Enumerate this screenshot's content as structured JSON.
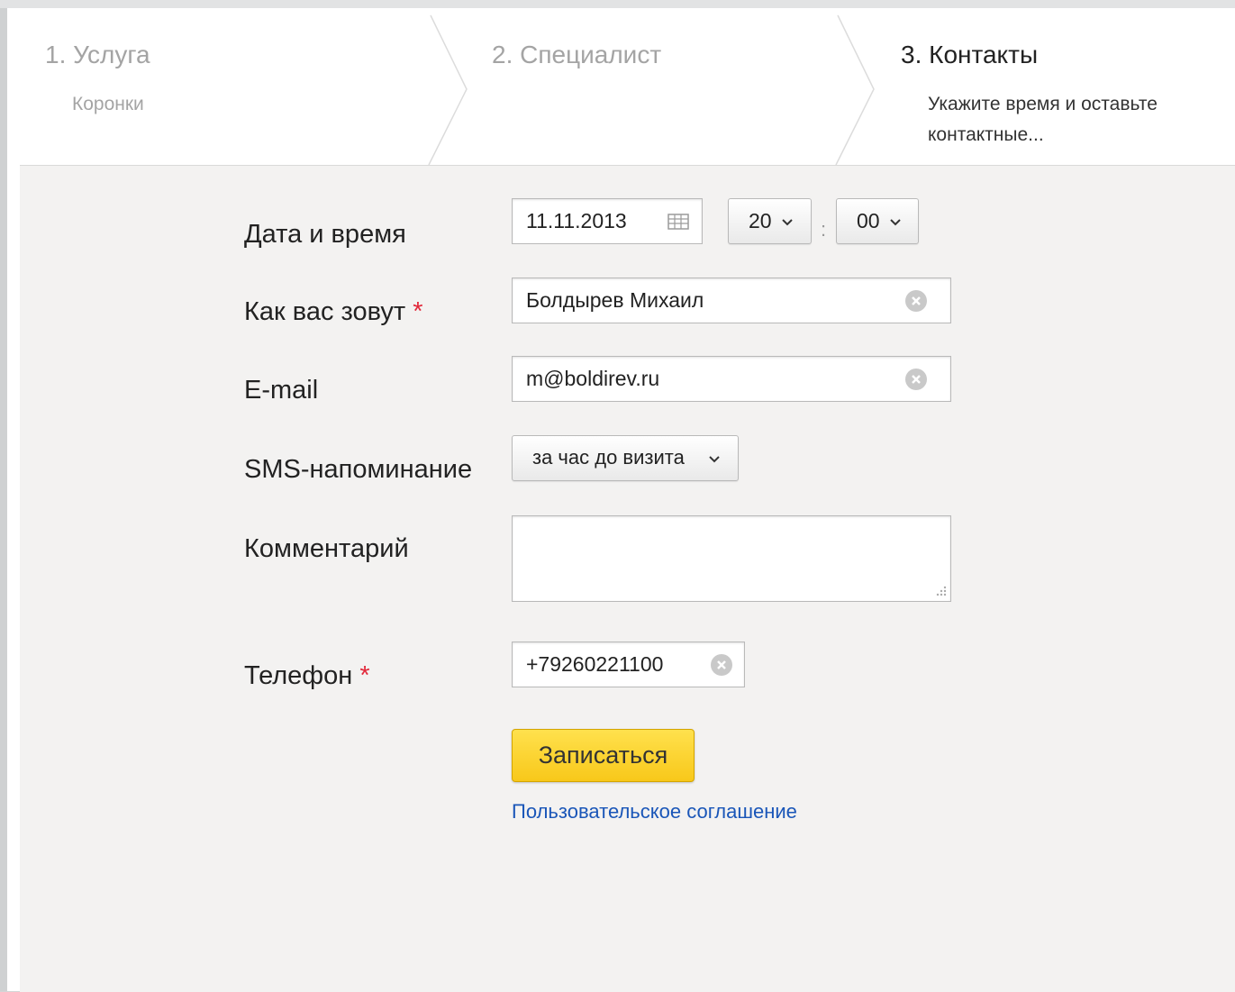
{
  "steps": [
    {
      "title": "1. Услуга",
      "subtitle": "Коронки"
    },
    {
      "title": "2. Специалист",
      "subtitle": ""
    },
    {
      "title": "3. Контакты",
      "subtitle": "Укажите время и оставьте контактные..."
    }
  ],
  "form": {
    "date_label": "Дата и время",
    "date_value": "11.11.2013",
    "hour_value": "20",
    "time_separator": ":",
    "minute_value": "00",
    "name_label": "Как вас зовут",
    "name_value": "Болдырев Михаил",
    "email_label": "E-mail",
    "email_value": "m@boldirev.ru",
    "sms_label": "SMS-напоминание",
    "sms_value": "за час до визита",
    "comment_label": "Комментарий",
    "comment_value": "",
    "phone_label": "Телефон",
    "phone_value": "+79260221100",
    "required_mark": "*",
    "submit_label": "Записаться",
    "agreement_link": "Пользовательское соглашение"
  },
  "colors": {
    "required": "#e2283a",
    "button": "#f8c81a",
    "link": "#1a56b8",
    "form_background": "#f3f2f1"
  },
  "icons": [
    "calendar-icon",
    "chevron-down-icon",
    "clear-icon",
    "resize-grip-icon",
    "close-icon"
  ]
}
